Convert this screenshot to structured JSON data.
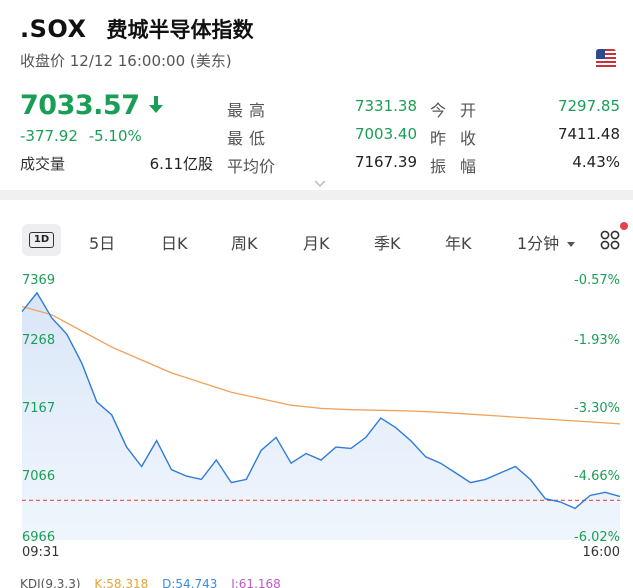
{
  "header": {
    "ticker": ".SOX",
    "name": "费城半导体指数",
    "status_line": "收盘价 12/12 16:00:00 (美东)",
    "flag_icon": "us-flag-icon"
  },
  "quote": {
    "price": "7033.57",
    "change": "-377.92",
    "change_pct": "-5.10%",
    "volume_label": "成交量",
    "volume_value": "6.11亿股",
    "direction_color": "#1a9e55"
  },
  "stats": {
    "high": {
      "label": "最高",
      "value": "7331.38"
    },
    "low": {
      "label": "最低",
      "value": "7003.40"
    },
    "avg": {
      "label": "平均价",
      "value": "7167.39"
    },
    "open": {
      "label": "今开",
      "value": "7297.85"
    },
    "prev_close": {
      "label": "昨收",
      "value": "7411.48"
    },
    "amplitude": {
      "label": "振幅",
      "value": "4.43%"
    }
  },
  "tabs": [
    {
      "label": "1D",
      "active": true
    },
    {
      "label": "5日"
    },
    {
      "label": "日K"
    },
    {
      "label": "周K"
    },
    {
      "label": "月K"
    },
    {
      "label": "季K"
    },
    {
      "label": "年K"
    },
    {
      "label": "1分钟"
    }
  ],
  "chart": {
    "y_left_ticks": [
      "7369",
      "7268",
      "7167",
      "7066",
      "6966"
    ],
    "y_right_ticks": [
      "-0.57%",
      "-1.93%",
      "-3.30%",
      "-4.66%",
      "-6.02%"
    ],
    "x_ticks": [
      "09:31",
      "16:00"
    ],
    "prev_close_line": 7411.48
  },
  "chart_data": {
    "type": "line",
    "title": "",
    "xlabel": "",
    "ylabel": "",
    "x_range": [
      "09:31",
      "16:00"
    ],
    "ylim": [
      6966,
      7369
    ],
    "grid": false,
    "series": [
      {
        "x": [
          0,
          1,
          2,
          3,
          4,
          5,
          6,
          7,
          8,
          9,
          10,
          11,
          12,
          13,
          14,
          15,
          16,
          17,
          18,
          19,
          20,
          21,
          22,
          23,
          24,
          25,
          26,
          27,
          28,
          29,
          30,
          31,
          32,
          33,
          34,
          35,
          36,
          37,
          38,
          39,
          40
        ],
        "values": [
          7320,
          7349,
          7310,
          7285,
          7240,
          7180,
          7160,
          7110,
          7080,
          7120,
          7075,
          7065,
          7060,
          7090,
          7055,
          7060,
          7105,
          7125,
          7085,
          7100,
          7090,
          7110,
          7108,
          7125,
          7155,
          7140,
          7120,
          7095,
          7085,
          7070,
          7055,
          7060,
          7070,
          7080,
          7060,
          7030,
          7025,
          7015,
          7035,
          7040,
          7033.57
        ],
        "color": "#2f7bd9"
      },
      {
        "x": [
          0,
          2,
          4,
          6,
          8,
          10,
          12,
          14,
          16,
          18,
          20,
          22,
          24,
          26,
          28,
          30,
          32,
          34,
          36,
          38,
          40
        ],
        "values": [
          7328,
          7315,
          7290,
          7265,
          7245,
          7225,
          7210,
          7195,
          7185,
          7175,
          7170,
          7168,
          7167,
          7166,
          7164,
          7161,
          7158,
          7155,
          7152,
          7149,
          7146
        ],
        "color": "#f0a15a"
      }
    ]
  },
  "indicator_bar": {
    "label": "KDJ(9,3,3)",
    "k": "K:58.318",
    "d": "D:54.743",
    "j": "J:61.168"
  }
}
